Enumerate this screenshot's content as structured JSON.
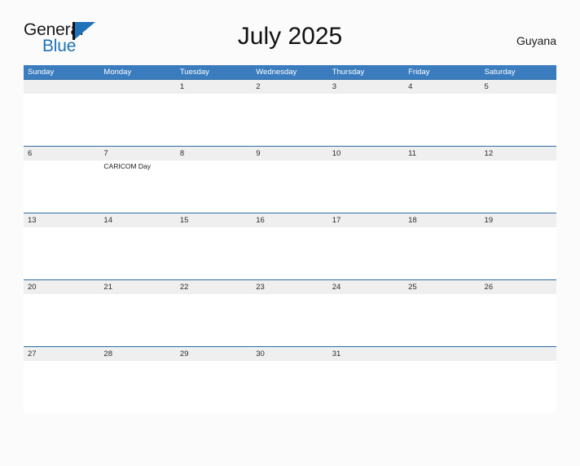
{
  "brand": {
    "name_part1": "General",
    "name_part2": "Blue",
    "mark": "triangle-flag-mark",
    "color_primary": "#1f72b8",
    "color_text": "#1a1a1a"
  },
  "header": {
    "title": "July 2025",
    "country": "Guyana"
  },
  "calendar": {
    "month": "July",
    "year": "2025",
    "header_bg": "#3a7cbe",
    "band_bg": "#efefef",
    "rule_color": "#2e6da4",
    "weekdays": [
      "Sunday",
      "Monday",
      "Tuesday",
      "Wednesday",
      "Thursday",
      "Friday",
      "Saturday"
    ],
    "weeks": [
      {
        "days": [
          {
            "date": "",
            "events": []
          },
          {
            "date": "",
            "events": []
          },
          {
            "date": "1",
            "events": []
          },
          {
            "date": "2",
            "events": []
          },
          {
            "date": "3",
            "events": []
          },
          {
            "date": "4",
            "events": []
          },
          {
            "date": "5",
            "events": []
          }
        ]
      },
      {
        "days": [
          {
            "date": "6",
            "events": []
          },
          {
            "date": "7",
            "events": [
              "CARICOM Day"
            ]
          },
          {
            "date": "8",
            "events": []
          },
          {
            "date": "9",
            "events": []
          },
          {
            "date": "10",
            "events": []
          },
          {
            "date": "11",
            "events": []
          },
          {
            "date": "12",
            "events": []
          }
        ]
      },
      {
        "days": [
          {
            "date": "13",
            "events": []
          },
          {
            "date": "14",
            "events": []
          },
          {
            "date": "15",
            "events": []
          },
          {
            "date": "16",
            "events": []
          },
          {
            "date": "17",
            "events": []
          },
          {
            "date": "18",
            "events": []
          },
          {
            "date": "19",
            "events": []
          }
        ]
      },
      {
        "days": [
          {
            "date": "20",
            "events": []
          },
          {
            "date": "21",
            "events": []
          },
          {
            "date": "22",
            "events": []
          },
          {
            "date": "23",
            "events": []
          },
          {
            "date": "24",
            "events": []
          },
          {
            "date": "25",
            "events": []
          },
          {
            "date": "26",
            "events": []
          }
        ]
      },
      {
        "days": [
          {
            "date": "27",
            "events": []
          },
          {
            "date": "28",
            "events": []
          },
          {
            "date": "29",
            "events": []
          },
          {
            "date": "30",
            "events": []
          },
          {
            "date": "31",
            "events": []
          },
          {
            "date": "",
            "events": []
          },
          {
            "date": "",
            "events": []
          }
        ]
      }
    ]
  }
}
